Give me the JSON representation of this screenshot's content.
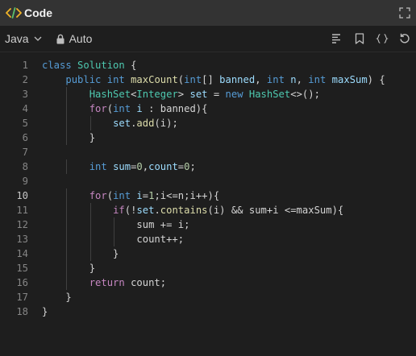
{
  "window": {
    "title": "Code",
    "title_icon": "code-brackets-icon",
    "fullscreen_icon": "fullscreen-icon"
  },
  "toolbar": {
    "language": "Java",
    "mode": "Auto",
    "icons": [
      "format-icon",
      "bookmark-icon",
      "braces-icon",
      "reset-icon"
    ]
  },
  "colors": {
    "keyword": "#569cd6",
    "type": "#4ec9b0",
    "control": "#c586c0",
    "function": "#dcdcaa",
    "variable": "#9cdcfe",
    "number": "#b5cea8",
    "brand_icon": "#f0b429"
  },
  "editor": {
    "active_line": 10,
    "lines": [
      {
        "n": "1",
        "t": [
          [
            "kw",
            "class"
          ],
          [
            "pl",
            " "
          ],
          [
            "ty",
            "Solution"
          ],
          [
            "pl",
            " {"
          ]
        ]
      },
      {
        "n": "2",
        "t": [
          [
            "pl",
            "    "
          ],
          [
            "kw",
            "public"
          ],
          [
            "pl",
            " "
          ],
          [
            "kw",
            "int"
          ],
          [
            "pl",
            " "
          ],
          [
            "fn",
            "maxCount"
          ],
          [
            "pl",
            "("
          ],
          [
            "kw",
            "int"
          ],
          [
            "pl",
            "[] "
          ],
          [
            "var",
            "banned"
          ],
          [
            "pl",
            ", "
          ],
          [
            "kw",
            "int"
          ],
          [
            "pl",
            " "
          ],
          [
            "var",
            "n"
          ],
          [
            "pl",
            ", "
          ],
          [
            "kw",
            "int"
          ],
          [
            "pl",
            " "
          ],
          [
            "var",
            "maxSum"
          ],
          [
            "pl",
            ") {"
          ]
        ]
      },
      {
        "n": "3",
        "t": [
          [
            "pl",
            "        "
          ],
          [
            "ty",
            "HashSet"
          ],
          [
            "pl",
            "<"
          ],
          [
            "ty",
            "Integer"
          ],
          [
            "pl",
            "> "
          ],
          [
            "var",
            "set"
          ],
          [
            "pl",
            " = "
          ],
          [
            "kw",
            "new"
          ],
          [
            "pl",
            " "
          ],
          [
            "ty",
            "HashSet"
          ],
          [
            "pl",
            "<>();"
          ]
        ]
      },
      {
        "n": "4",
        "t": [
          [
            "pl",
            "        "
          ],
          [
            "ctl",
            "for"
          ],
          [
            "pl",
            "("
          ],
          [
            "kw",
            "int"
          ],
          [
            "pl",
            " "
          ],
          [
            "var",
            "i"
          ],
          [
            "pl",
            " : banned){"
          ]
        ]
      },
      {
        "n": "5",
        "t": [
          [
            "pl",
            "            "
          ],
          [
            "var",
            "set"
          ],
          [
            "pl",
            "."
          ],
          [
            "fn",
            "add"
          ],
          [
            "pl",
            "(i);"
          ]
        ]
      },
      {
        "n": "6",
        "t": [
          [
            "pl",
            "        }"
          ]
        ]
      },
      {
        "n": "7",
        "t": []
      },
      {
        "n": "8",
        "t": [
          [
            "pl",
            "        "
          ],
          [
            "kw",
            "int"
          ],
          [
            "pl",
            " "
          ],
          [
            "var",
            "sum"
          ],
          [
            "pl",
            "="
          ],
          [
            "num",
            "0"
          ],
          [
            "pl",
            ","
          ],
          [
            "var",
            "count"
          ],
          [
            "pl",
            "="
          ],
          [
            "num",
            "0"
          ],
          [
            "pl",
            ";"
          ]
        ]
      },
      {
        "n": "9",
        "t": []
      },
      {
        "n": "10",
        "t": [
          [
            "pl",
            "        "
          ],
          [
            "ctl",
            "for"
          ],
          [
            "pl",
            "("
          ],
          [
            "kw",
            "int"
          ],
          [
            "pl",
            " "
          ],
          [
            "var",
            "i"
          ],
          [
            "pl",
            "="
          ],
          [
            "num",
            "1"
          ],
          [
            "pl",
            ";i<=n;i++){"
          ]
        ]
      },
      {
        "n": "11",
        "t": [
          [
            "pl",
            "            "
          ],
          [
            "ctl",
            "if"
          ],
          [
            "pl",
            "(!"
          ],
          [
            "var",
            "set"
          ],
          [
            "pl",
            "."
          ],
          [
            "fn",
            "contains"
          ],
          [
            "pl",
            "(i) && sum+i <=maxSum){"
          ]
        ]
      },
      {
        "n": "12",
        "t": [
          [
            "pl",
            "                sum += i;"
          ]
        ]
      },
      {
        "n": "13",
        "t": [
          [
            "pl",
            "                count++;"
          ]
        ]
      },
      {
        "n": "14",
        "t": [
          [
            "pl",
            "            }"
          ]
        ]
      },
      {
        "n": "15",
        "t": [
          [
            "pl",
            "        }"
          ]
        ]
      },
      {
        "n": "16",
        "t": [
          [
            "pl",
            "        "
          ],
          [
            "ctl",
            "return"
          ],
          [
            "pl",
            " count;"
          ]
        ]
      },
      {
        "n": "17",
        "t": [
          [
            "pl",
            "    }"
          ]
        ]
      },
      {
        "n": "18",
        "t": [
          [
            "pl",
            "}"
          ]
        ]
      }
    ]
  }
}
